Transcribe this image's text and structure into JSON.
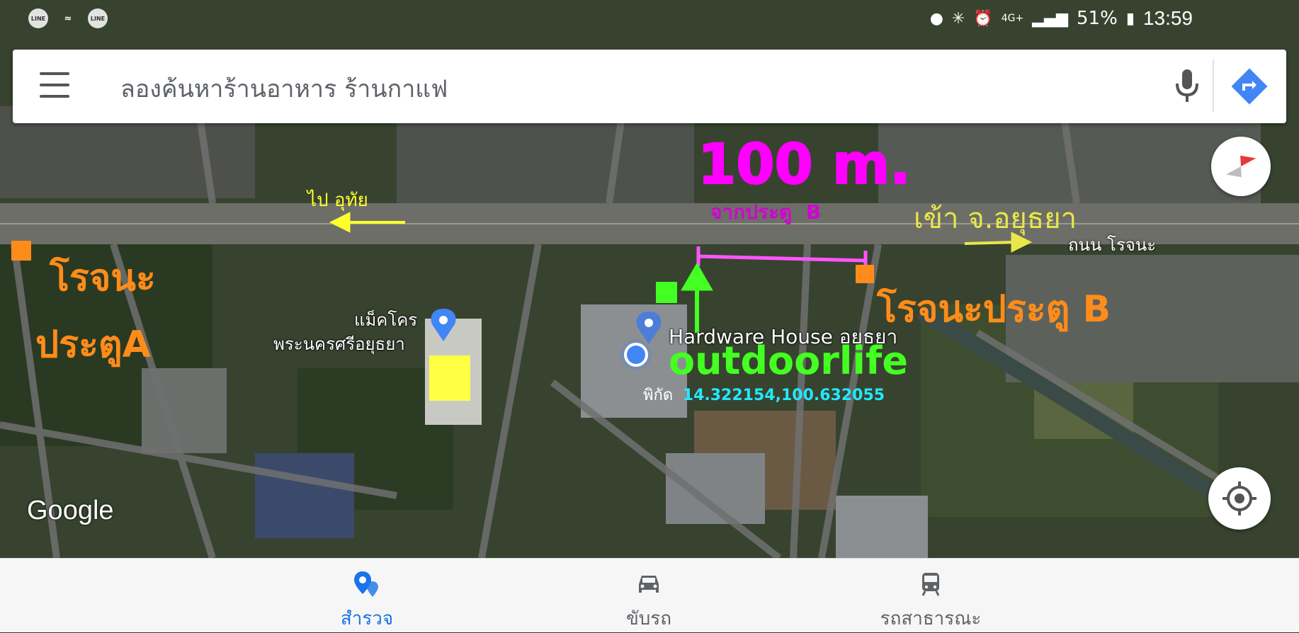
{
  "status_bar": {
    "left_icons": [
      "line-icon",
      "wifi-icon",
      "line-icon"
    ],
    "line_label": "LINE",
    "battery": "51%",
    "network": "4G+",
    "time": "13:59"
  },
  "search": {
    "placeholder": "ลองค้นหาร้านอาหาร ร้านกาแฟ"
  },
  "map": {
    "annotations": {
      "distance": "100 m.",
      "from_gate_prefix": "จากประตู",
      "from_gate_letter": "B",
      "to_ayutthaya": "เข้า จ.อยุธยา",
      "road_name": "ถนน โรจนะ",
      "to_uthai": "ไป อุทัย",
      "gate_a_line1": "โรจนะ",
      "gate_a_line2": "ประตูA",
      "gate_b": "โรจนะประตู B",
      "outdoorlife": "outdoorlife",
      "coord_label": "พิกัด",
      "coord_value": "14.322154,100.632055"
    },
    "places": {
      "makro_line1": "แม็คโคร",
      "makro_line2": "พระนครศรีอยุธยา",
      "hardware_house": "Hardware House อยุธยา"
    },
    "watermark": "Google",
    "colors": {
      "annotation_magenta": "#ff00ff",
      "annotation_orange": "#ff8c1a",
      "annotation_green": "#44ff22",
      "annotation_yellow": "#ffff2e",
      "annotation_cyan": "#22e8ff",
      "location_dot": "#4285f4"
    }
  },
  "bottom_nav": {
    "items": [
      {
        "label": "สำรวจ",
        "icon": "explore-pin-icon",
        "active": true
      },
      {
        "label": "ขับรถ",
        "icon": "car-icon",
        "active": false
      },
      {
        "label": "รถสาธารณะ",
        "icon": "transit-icon",
        "active": false
      }
    ]
  }
}
